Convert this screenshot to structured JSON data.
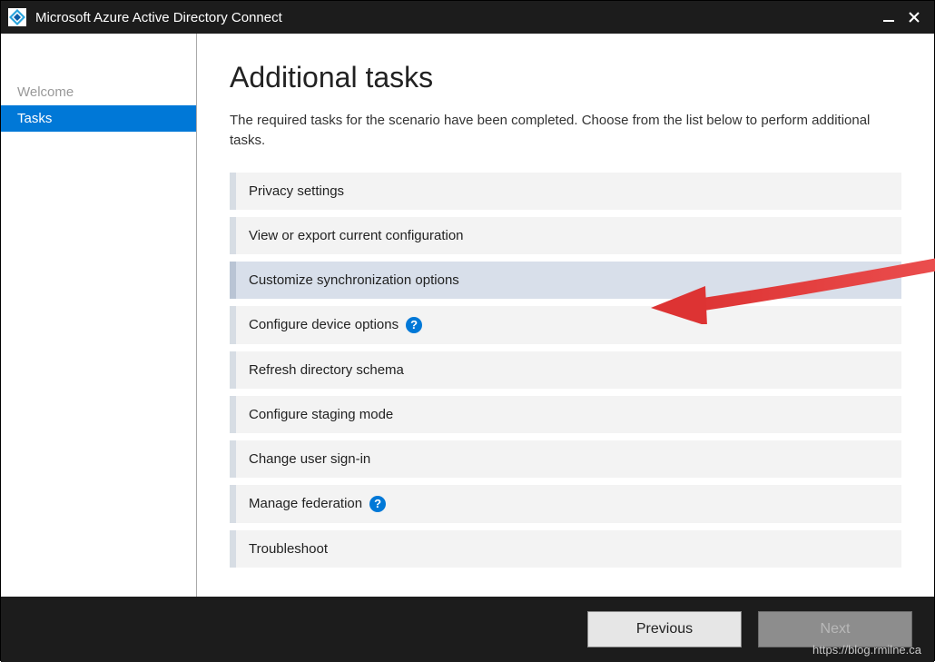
{
  "window": {
    "title": "Microsoft Azure Active Directory Connect"
  },
  "sidebar": {
    "items": [
      {
        "label": "Welcome",
        "active": false
      },
      {
        "label": "Tasks",
        "active": true
      }
    ]
  },
  "main": {
    "title": "Additional tasks",
    "description": "The required tasks for the scenario have been completed. Choose from the list below to perform additional tasks.",
    "tasks": [
      {
        "label": "Privacy settings",
        "help": false,
        "selected": false
      },
      {
        "label": "View or export current configuration",
        "help": false,
        "selected": false
      },
      {
        "label": "Customize synchronization options",
        "help": false,
        "selected": true
      },
      {
        "label": "Configure device options",
        "help": true,
        "selected": false
      },
      {
        "label": "Refresh directory schema",
        "help": false,
        "selected": false
      },
      {
        "label": "Configure staging mode",
        "help": false,
        "selected": false
      },
      {
        "label": "Change user sign-in",
        "help": false,
        "selected": false
      },
      {
        "label": "Manage federation",
        "help": true,
        "selected": false
      },
      {
        "label": "Troubleshoot",
        "help": false,
        "selected": false
      }
    ]
  },
  "footer": {
    "previous": "Previous",
    "next": "Next",
    "watermark": "https://blog.rmilne.ca"
  }
}
